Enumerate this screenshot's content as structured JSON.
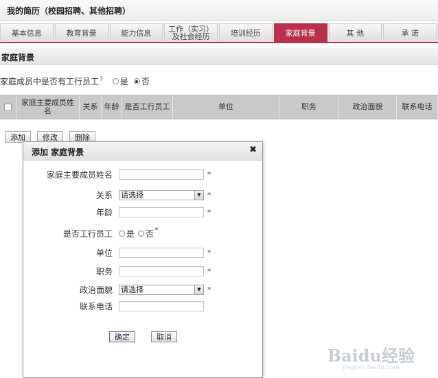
{
  "header": {
    "title": "我的简历（校园招聘、其他招聘）"
  },
  "tabs": [
    {
      "label": "基本信息",
      "active": false
    },
    {
      "label": "教育背景",
      "active": false
    },
    {
      "label": "能力信息",
      "active": false
    },
    {
      "label": "工作（实习）\n及社会经历",
      "active": false
    },
    {
      "label": "培训经历",
      "active": false
    },
    {
      "label": "家庭背景",
      "active": true
    },
    {
      "label": "其 他",
      "active": false
    },
    {
      "label": "承 诺",
      "active": false
    }
  ],
  "section": {
    "title": "家庭背景",
    "question": "家庭成员中是否有工行员工",
    "help_mark": "?",
    "options": {
      "yes": "是",
      "no": "否"
    },
    "selected": "no"
  },
  "grid": {
    "columns": [
      "家庭主要成员姓名",
      "关系",
      "年龄",
      "是否工行员工",
      "单位",
      "职务",
      "政治面貌",
      "联系电话"
    ]
  },
  "actions": {
    "add": "添加",
    "edit": "修改",
    "delete": "删除"
  },
  "dialog": {
    "title": "添加 家庭背景",
    "close_glyph": "✖",
    "fields": {
      "name": "家庭主要成员姓名",
      "relation": "关系",
      "age": "年龄",
      "icbc_employee": "是否工行员工",
      "unit": "单位",
      "position": "职务",
      "political": "政治面貌",
      "phone": "联系电话"
    },
    "select_placeholder": "请选择",
    "radio": {
      "yes": "是",
      "no": "否"
    },
    "required_mark": "*",
    "buttons": {
      "confirm": "确定",
      "cancel": "取消"
    }
  },
  "watermark": {
    "logo": "Baidu经验",
    "url": "jingyan.baidu.com"
  },
  "colors": {
    "accent": "#b9304a",
    "header_bg": "#c9c9c9"
  }
}
